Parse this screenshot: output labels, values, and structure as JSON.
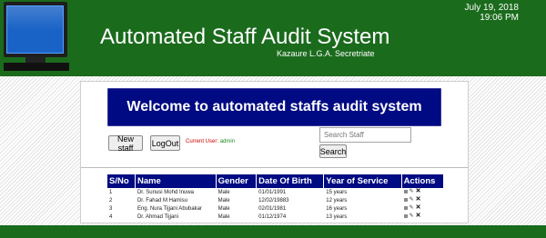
{
  "header": {
    "title": "Automated Staff Audit System",
    "subtitle": "Kazaure L.G.A. Secretriate",
    "date": "July 19, 2018",
    "time": "19:06 PM",
    "logo_icon": "computer-monitor-icon",
    "background_color": "#1b6b1d"
  },
  "banner": {
    "text": "Welcome to automated staffs audit system",
    "background_color": "#000a82"
  },
  "toolbar": {
    "new_staff_label": "New staff",
    "logout_label": "LogOut",
    "current_user_label": "Current User:",
    "current_user_name": "admin"
  },
  "search": {
    "placeholder": "Search Staff",
    "value": "",
    "button_label": "Search"
  },
  "table": {
    "headers": [
      "S/No",
      "Name",
      "Gender",
      "Date Of Birth",
      "Year of Service",
      "Actions"
    ],
    "rows": [
      [
        "1",
        "Dr. Sunusi Mohd Inuwa",
        "Male",
        "01/01/1991",
        "15 years"
      ],
      [
        "2",
        "Dr. Fahad M Hamisu",
        "Male",
        "12/02/19883",
        "12 years"
      ],
      [
        "3",
        "Eng. Nura Tijjani Abubakar",
        "Male",
        "02/01/1981",
        "16 years"
      ],
      [
        "4",
        "Dr. Ahmad Tijjani",
        "Male",
        "01/12/1974",
        "13 years"
      ]
    ],
    "action_icons": [
      "view-icon",
      "edit-icon",
      "delete-icon"
    ],
    "header_color": "#000a82"
  }
}
